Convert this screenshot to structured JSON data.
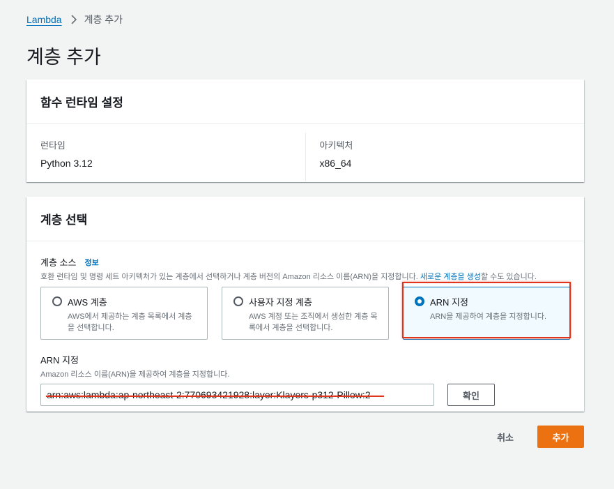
{
  "breadcrumb": {
    "root": "Lambda",
    "current": "계층 추가"
  },
  "page": {
    "title": "계층 추가"
  },
  "runtime_settings": {
    "title": "함수 런타임 설정",
    "runtime_label": "런타임",
    "runtime_value": "Python 3.12",
    "architecture_label": "아키텍처",
    "architecture_value": "x86_64"
  },
  "layer_selection": {
    "title": "계층 선택",
    "source_label": "계층 소스",
    "info_link": "정보",
    "description_prefix": "호환 런타임 및 명령 세트 아키텍처가 있는 계층에서 선택하거나 계층 버전의 Amazon 리소스 이름(ARN)을 지정합니다. ",
    "description_link": "새로운 계층을 생성",
    "description_suffix": "할 수도 있습니다.",
    "options": [
      {
        "title": "AWS 계층",
        "description": "AWS에서 제공하는 계층 목록에서 계층을 선택합니다.",
        "selected": false
      },
      {
        "title": "사용자 지정 계층",
        "description": "AWS 계정 또는 조직에서 생성한 계층 목록에서 계층을 선택합니다.",
        "selected": false
      },
      {
        "title": "ARN 지정",
        "description": "ARN을 제공하여 계층을 지정합니다.",
        "selected": true
      }
    ],
    "arn": {
      "label": "ARN 지정",
      "description": "Amazon 리소스 이름(ARN)을 제공하여 계층을 지정합니다.",
      "value": "arn:aws:lambda:ap-northeast-2:770693421928:layer:Klayers-p312-Pillow:2",
      "verify_button": "확인"
    }
  },
  "footer": {
    "cancel_button": "취소",
    "add_button": "추가"
  },
  "colors": {
    "accent": "#0073bb",
    "primary_button": "#ec7211",
    "annotation": "#e0341c"
  }
}
